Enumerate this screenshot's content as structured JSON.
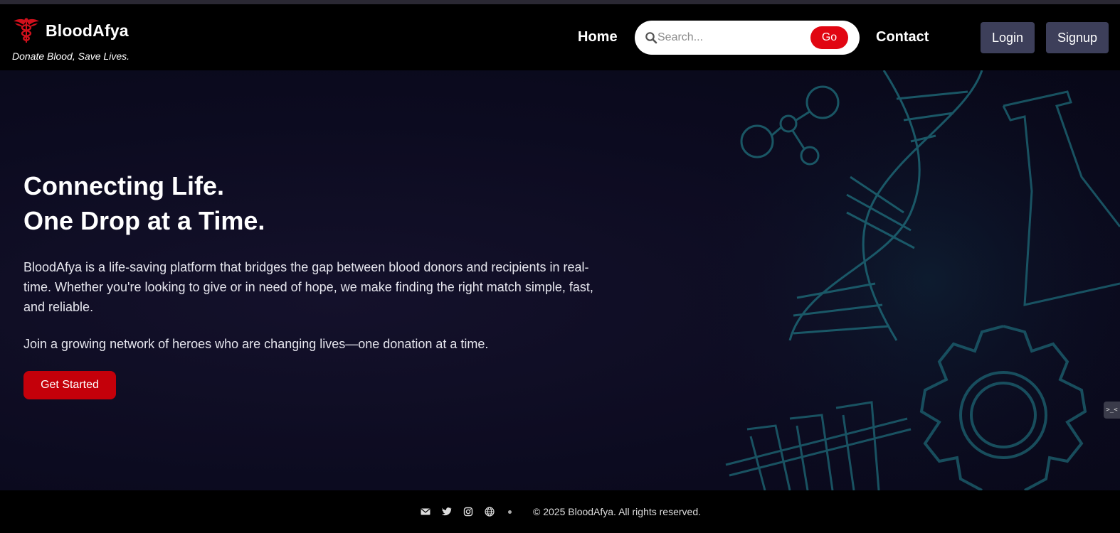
{
  "brand": {
    "name": "BloodAfya",
    "tagline": "Donate Blood, Save Lives.",
    "accent_color": "#e10612",
    "logo_icon": "caduceus-icon"
  },
  "nav": {
    "home_label": "Home",
    "contact_label": "Contact",
    "search": {
      "placeholder": "Search...",
      "value": "",
      "button_label": "Go",
      "icon": "search-icon"
    },
    "login_label": "Login",
    "signup_label": "Signup"
  },
  "hero": {
    "title_line1": "Connecting Life.",
    "title_line2": "One Drop at a Time.",
    "paragraph1": "BloodAfya is a life-saving platform that bridges the gap between blood donors and recipients in real-time. Whether you're looking to give or in need of hope, we make finding the right match simple, fast, and reliable.",
    "paragraph2": "Join a growing network of heroes who are changing lives—one donation at a time.",
    "cta_label": "Get Started",
    "background_icons": [
      "dna-helix-icon",
      "molecule-icon",
      "flask-icon",
      "gear-icon",
      "test-tubes-icon"
    ]
  },
  "side_widget": {
    "label": ">_<"
  },
  "footer": {
    "icons": [
      "envelope-icon",
      "twitter-icon",
      "instagram-icon",
      "globe-icon"
    ],
    "copyright": "© 2025 BloodAfya. All rights reserved."
  }
}
